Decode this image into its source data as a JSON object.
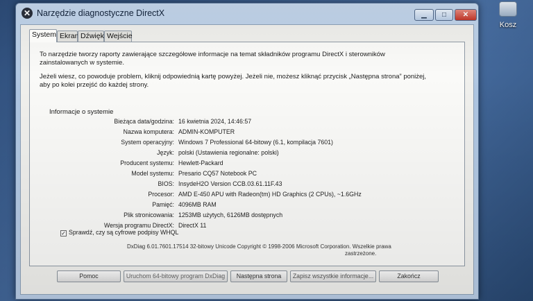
{
  "desktop": {
    "icon_label": "Kosz",
    "icon_name": "recycle-bin-icon"
  },
  "window": {
    "title": "Narzędzie diagnostyczne DirectX",
    "app_icon_glyph": "✕",
    "controls": {
      "min": "▁",
      "max": "□",
      "close": "✕"
    }
  },
  "tabs": [
    {
      "label": "System",
      "active": true
    },
    {
      "label": "Ekran",
      "active": false
    },
    {
      "label": "Dźwięk",
      "active": false
    },
    {
      "label": "Wejście",
      "active": false
    }
  ],
  "intro": {
    "p1": "To narzędzie tworzy raporty zawierające szczegółowe informacje na temat składników programu DirectX i sterowników zainstalowanych w systemie.",
    "p2": "Jeżeli wiesz, co powoduje problem, kliknij odpowiednią kartę powyżej. Jeżeli nie, możesz kliknąć przycisk „Następna strona” poniżej, aby po kolei przejść do każdej strony."
  },
  "system_info": {
    "section_title": "Informacje o systemie",
    "rows": [
      {
        "key": "Bieżąca data/godzina:",
        "value": "16 kwietnia 2024, 14:46:57"
      },
      {
        "key": "Nazwa komputera:",
        "value": "ADMIN-KOMPUTER"
      },
      {
        "key": "System operacyjny:",
        "value": "Windows 7 Professional 64-bitowy (6.1, kompilacja 7601)"
      },
      {
        "key": "Język:",
        "value": "polski (Ustawienia regionalne: polski)"
      },
      {
        "key": "Producent systemu:",
        "value": "Hewlett-Packard"
      },
      {
        "key": "Model systemu:",
        "value": "Presario CQ57 Notebook PC"
      },
      {
        "key": "BIOS:",
        "value": "InsydeH2O Version CCB.03.61.11F.43"
      },
      {
        "key": "Procesor:",
        "value": "AMD E-450 APU with Radeon(tm) HD Graphics (2 CPUs), ~1.6GHz"
      },
      {
        "key": "Pamięć:",
        "value": "4096MB RAM"
      },
      {
        "key": "Plik stronicowania:",
        "value": "1253MB użytych, 6126MB dostępnych"
      },
      {
        "key": "Wersja programu DirectX:",
        "value": "DirectX 11"
      }
    ]
  },
  "whql": {
    "label": "Sprawdź, czy są cyfrowe podpisy WHQL",
    "checked": true,
    "check_glyph": "✓"
  },
  "footer": {
    "line1": "DxDiag 6.01.7601.17514 32-bitowy Unicode  Copyright © 1998-2006 Microsoft Corporation. Wszelkie prawa",
    "line2": "zastrzeżone."
  },
  "buttons": {
    "help": "Pomoc",
    "run64": "Uruchom 64-bitowy program DxDiag",
    "next": "Następna strona",
    "save": "Zapisz wszystkie informacje...",
    "exit": "Zakończ"
  }
}
